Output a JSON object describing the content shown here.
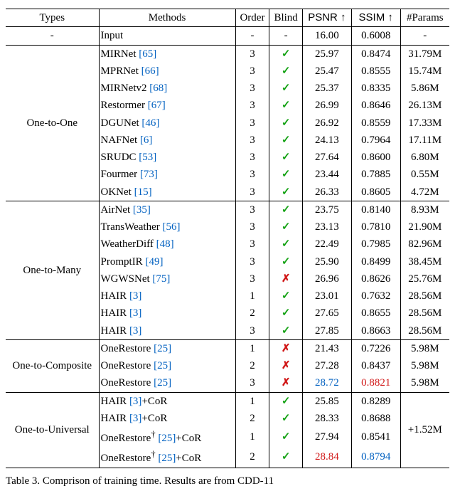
{
  "chart_data": {
    "type": "table",
    "columns": [
      "Types",
      "Methods",
      "Order",
      "Blind",
      "PSNR ↑",
      "SSIM ↑",
      "#Params"
    ],
    "groups": [
      {
        "type": "-",
        "rows": [
          {
            "method": "Input",
            "cite": "",
            "order": "-",
            "blind": "-",
            "psnr": "16.00",
            "ssim": "0.6008",
            "params": "-"
          }
        ]
      },
      {
        "type": "One-to-One",
        "rows": [
          {
            "method": "MIRNet",
            "cite": "[65]",
            "order": "3",
            "blind": "check",
            "psnr": "25.97",
            "ssim": "0.8474",
            "params": "31.79M"
          },
          {
            "method": "MPRNet",
            "cite": "[66]",
            "order": "3",
            "blind": "check",
            "psnr": "25.47",
            "ssim": "0.8555",
            "params": "15.74M"
          },
          {
            "method": "MIRNetv2",
            "cite": "[68]",
            "order": "3",
            "blind": "check",
            "psnr": "25.37",
            "ssim": "0.8335",
            "params": "5.86M"
          },
          {
            "method": "Restormer",
            "cite": "[67]",
            "order": "3",
            "blind": "check",
            "psnr": "26.99",
            "ssim": "0.8646",
            "params": "26.13M"
          },
          {
            "method": "DGUNet",
            "cite": "[46]",
            "order": "3",
            "blind": "check",
            "psnr": "26.92",
            "ssim": "0.8559",
            "params": "17.33M"
          },
          {
            "method": "NAFNet",
            "cite": "[6]",
            "order": "3",
            "blind": "check",
            "psnr": "24.13",
            "ssim": "0.7964",
            "params": "17.11M"
          },
          {
            "method": "SRUDC",
            "cite": "[53]",
            "order": "3",
            "blind": "check",
            "psnr": "27.64",
            "ssim": "0.8600",
            "params": "6.80M"
          },
          {
            "method": "Fourmer",
            "cite": "[73]",
            "order": "3",
            "blind": "check",
            "psnr": "23.44",
            "ssim": "0.7885",
            "params": "0.55M"
          },
          {
            "method": "OKNet",
            "cite": "[15]",
            "order": "3",
            "blind": "check",
            "psnr": "26.33",
            "ssim": "0.8605",
            "params": "4.72M"
          }
        ]
      },
      {
        "type": "One-to-Many",
        "rows": [
          {
            "method": "AirNet",
            "cite": "[35]",
            "order": "3",
            "blind": "check",
            "psnr": "23.75",
            "ssim": "0.8140",
            "params": "8.93M"
          },
          {
            "method": "TransWeather",
            "cite": "[56]",
            "order": "3",
            "blind": "check",
            "psnr": "23.13",
            "ssim": "0.7810",
            "params": "21.90M"
          },
          {
            "method": "WeatherDiff",
            "cite": "[48]",
            "order": "3",
            "blind": "check",
            "psnr": "22.49",
            "ssim": "0.7985",
            "params": "82.96M"
          },
          {
            "method": "PromptIR",
            "cite": "[49]",
            "order": "3",
            "blind": "check",
            "psnr": "25.90",
            "ssim": "0.8499",
            "params": "38.45M"
          },
          {
            "method": "WGWSNet",
            "cite": "[75]",
            "order": "3",
            "blind": "cross",
            "psnr": "26.96",
            "ssim": "0.8626",
            "params": "25.76M"
          },
          {
            "method": "HAIR",
            "cite": "[3]",
            "order": "1",
            "blind": "check",
            "psnr": "23.01",
            "ssim": "0.7632",
            "params": "28.56M"
          },
          {
            "method": "HAIR",
            "cite": "[3]",
            "order": "2",
            "blind": "check",
            "psnr": "27.65",
            "ssim": "0.8655",
            "params": "28.56M"
          },
          {
            "method": "HAIR",
            "cite": "[3]",
            "order": "3",
            "blind": "check",
            "psnr": "27.85",
            "ssim": "0.8663",
            "params": "28.56M"
          }
        ]
      },
      {
        "type": "One-to-Composite",
        "rows": [
          {
            "method": "OneRestore",
            "cite": "[25]",
            "order": "1",
            "blind": "cross",
            "psnr": "21.43",
            "ssim": "0.7226",
            "params": "5.98M"
          },
          {
            "method": "OneRestore",
            "cite": "[25]",
            "order": "2",
            "blind": "cross",
            "psnr": "27.28",
            "ssim": "0.8437",
            "params": "5.98M"
          },
          {
            "method": "OneRestore",
            "cite": "[25]",
            "order": "3",
            "blind": "cross",
            "psnr": "28.72",
            "psnr_hl": "blue",
            "ssim": "0.8821",
            "ssim_hl": "red",
            "params": "5.98M"
          }
        ]
      },
      {
        "type": "One-to-Universal",
        "params_merged": "+1.52M",
        "rows": [
          {
            "method": "HAIR",
            "cite": "[3]",
            "suffix": "+CoR",
            "order": "1",
            "blind": "check",
            "psnr": "25.85",
            "ssim": "0.8289"
          },
          {
            "method": "HAIR",
            "cite": "[3]",
            "suffix": "+CoR",
            "order": "2",
            "blind": "check",
            "psnr": "28.33",
            "ssim": "0.8688"
          },
          {
            "method": "OneRestore",
            "dagger": true,
            "cite": "[25]",
            "suffix": "+CoR",
            "order": "1",
            "blind": "check",
            "psnr": "27.94",
            "ssim": "0.8541"
          },
          {
            "method": "OneRestore",
            "dagger": true,
            "cite": "[25]",
            "suffix": "+CoR",
            "order": "2",
            "blind": "check",
            "psnr": "28.84",
            "psnr_hl": "red",
            "ssim": "0.8794",
            "ssim_hl": "blue"
          }
        ]
      }
    ]
  },
  "header": {
    "types": "Types",
    "methods": "Methods",
    "order": "Order",
    "blind": "Blind",
    "psnr": "PSNR ↑",
    "ssim": "SSIM ↑",
    "params": "#Params"
  },
  "symbols": {
    "check": "✓",
    "cross": "✗",
    "dagger": "†"
  },
  "caption": {
    "label": "Table 3.",
    "text": "Comprison of training time.  Results are from CDD-11"
  }
}
